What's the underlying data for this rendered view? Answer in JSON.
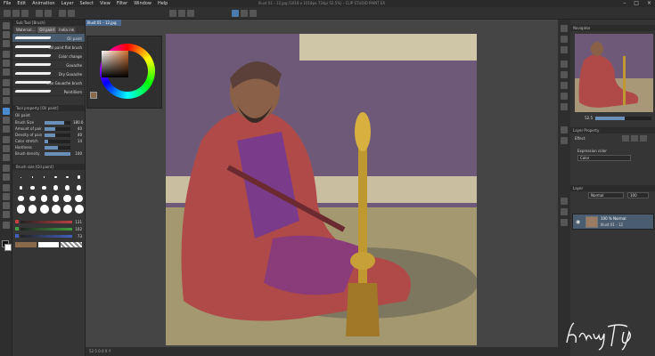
{
  "window": {
    "title": "Illust 01 - 12.jpg (1018 x 1018px 72dpi 52.5%) - CLIP STUDIO PAINT EX"
  },
  "menu": [
    "File",
    "Edit",
    "Animation",
    "Layer",
    "Select",
    "View",
    "Filter",
    "Window",
    "Help"
  ],
  "sub_tool_panel": {
    "title": "Sub Tool [Brush]",
    "tabs": [
      "Watercol...",
      "Oil paint",
      "India ink"
    ],
    "brushes": [
      "Oil paint",
      "Oil paint flat brush",
      "Color change",
      "Gouache",
      "Dry Gouache",
      "Thin Gouache brush",
      "Pointillism"
    ],
    "selected": "Oil paint",
    "tab_selected": "Oil paint"
  },
  "tool_property": {
    "title": "Tool property [Oil paint]",
    "brush_name": "Oil paint",
    "rows": [
      {
        "label": "Brush Size",
        "value": "180.0",
        "fill": 0.75
      },
      {
        "label": "Amount of paint",
        "value": "40",
        "fill": 0.4
      },
      {
        "label": "Density of paint",
        "value": "40",
        "fill": 0.4
      },
      {
        "label": "Color stretch",
        "value": "14",
        "fill": 0.14
      },
      {
        "label": "Hardness",
        "value": "",
        "fill": 0.5
      },
      {
        "label": "Brush density",
        "value": "100",
        "fill": 1.0
      }
    ]
  },
  "brush_size_panel": {
    "title": "Brush size [Oil paint]",
    "sizes": [
      "0.7",
      "1",
      "1.5",
      "2",
      "2.5",
      "3",
      "4",
      "5",
      "6",
      "7",
      "8",
      "10",
      "12",
      "15",
      "17",
      "20",
      "25",
      "30",
      "40",
      "50",
      "60",
      "70",
      "80",
      "100"
    ]
  },
  "color_sliders": {
    "values": [
      "131",
      "102",
      "73"
    ],
    "colors": [
      "#c04040",
      "#40a040",
      "#4060c0"
    ]
  },
  "document": {
    "tab_label": "Illust 01 - 12.jpg",
    "status": "52.5  0.0  X  Y"
  },
  "navigator": {
    "title": "Navigator",
    "zoom": "52.5"
  },
  "layer_property": {
    "title": "Layer Property",
    "section": "Effect",
    "expression_color_label": "Expression color",
    "expression_color_value": "Color"
  },
  "layers": {
    "title": "Layer",
    "blend_mode": "Normal",
    "opacity": "100",
    "items": [
      {
        "name": "100 % Normal",
        "sub": "Illust 01 - 12"
      }
    ]
  },
  "signature": "Khany Tj",
  "colors": {
    "accent": "#4c8ad0",
    "selection": "#4a5c70"
  }
}
